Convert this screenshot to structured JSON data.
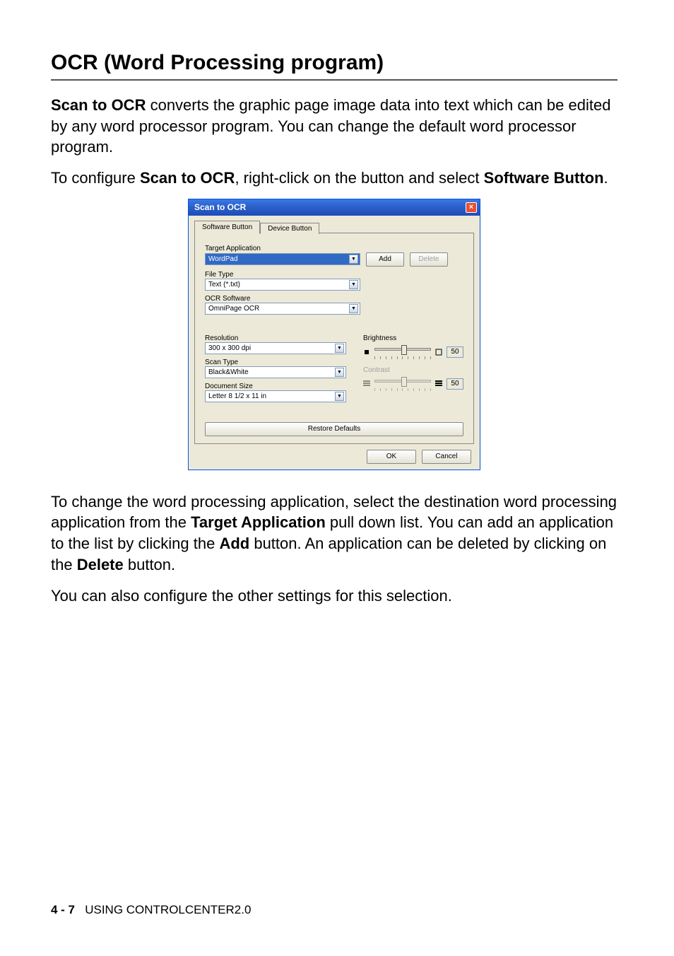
{
  "heading": "OCR (Word Processing program)",
  "para1_prefix_bold": "Scan to OCR",
  "para1_rest": " converts the graphic page image data into text which can be edited by any word processor program. You can change the default word processor program.",
  "para2_a": "To configure ",
  "para2_b_bold": "Scan to OCR",
  "para2_c": ", right-click on the button and select ",
  "para2_d_bold": "Software Button",
  "para2_e": ".",
  "dialog": {
    "title": "Scan to OCR",
    "tabs": {
      "software": "Software Button",
      "device": "Device Button"
    },
    "labels": {
      "target_app": "Target Application",
      "file_type": "File Type",
      "ocr_software": "OCR Software",
      "resolution": "Resolution",
      "scan_type": "Scan Type",
      "doc_size": "Document Size",
      "brightness": "Brightness",
      "contrast": "Contrast",
      "restore": "Restore Defaults",
      "ok": "OK",
      "cancel": "Cancel",
      "add": "Add",
      "delete": "Delete"
    },
    "values": {
      "target_app": "WordPad",
      "file_type": "Text (*.txt)",
      "ocr_software": "OmniPage OCR",
      "resolution": "300 x 300 dpi",
      "scan_type": "Black&White",
      "doc_size": "Letter 8 1/2 x 11 in",
      "brightness": "50",
      "contrast": "50"
    }
  },
  "para3_a": "To change the word processing application, select the destination word processing application from the ",
  "para3_b_bold": "Target Application",
  "para3_c": " pull down list. You can add an application to the list by clicking the ",
  "para3_d_bold": "Add",
  "para3_e": " button. An application can be deleted by clicking on the ",
  "para3_f_bold": "Delete",
  "para3_g": " button.",
  "para4": "You can also configure the other settings for this selection.",
  "footer_page": "4 - 7",
  "footer_text": "USING CONTROLCENTER2.0"
}
